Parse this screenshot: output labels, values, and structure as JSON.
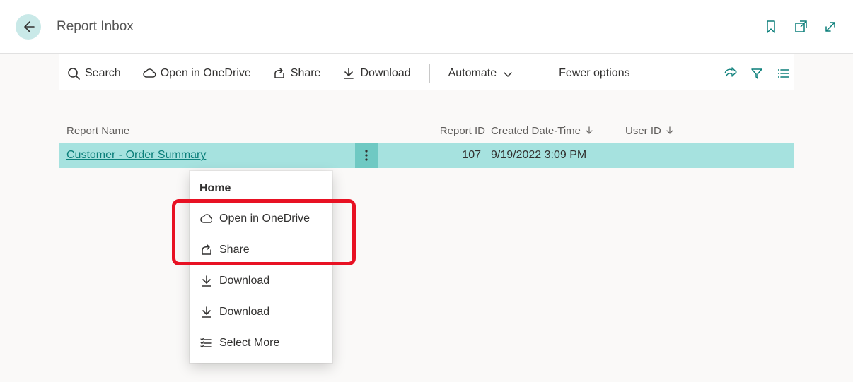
{
  "header": {
    "title": "Report Inbox"
  },
  "toolbar": {
    "search_label": "Search",
    "onedrive_label": "Open in OneDrive",
    "share_label": "Share",
    "download_label": "Download",
    "automate_label": "Automate",
    "fewer_label": "Fewer options"
  },
  "table": {
    "columns": {
      "name": "Report Name",
      "id": "Report ID",
      "created": "Created Date-Time",
      "user": "User ID"
    },
    "rows": [
      {
        "name": "Customer - Order Summary",
        "id": "107",
        "created": "9/19/2022 3:09 PM",
        "user": ""
      }
    ]
  },
  "context_menu": {
    "header": "Home",
    "items": [
      {
        "icon": "cloud-icon",
        "label": "Open in OneDrive"
      },
      {
        "icon": "share-arrow-icon",
        "label": "Share"
      },
      {
        "icon": "download-icon",
        "label": "Download"
      },
      {
        "icon": "download-icon",
        "label": "Download"
      },
      {
        "icon": "select-more-icon",
        "label": "Select More"
      }
    ]
  }
}
